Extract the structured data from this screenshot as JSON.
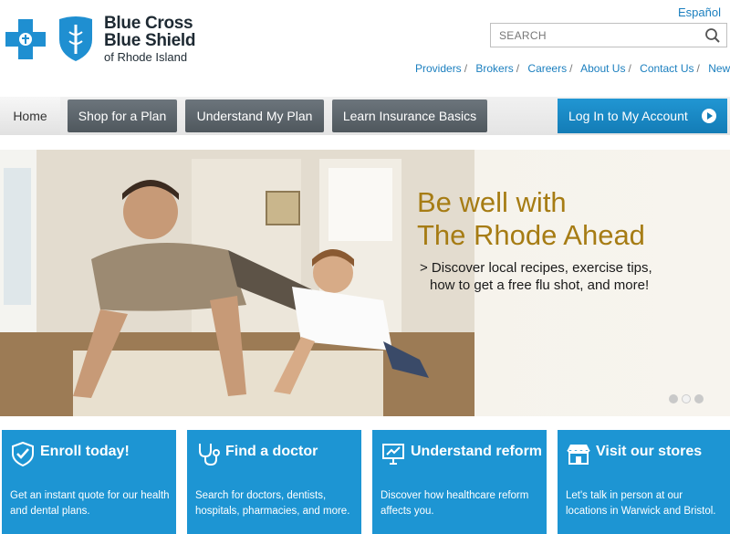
{
  "header": {
    "logo": {
      "line1": "Blue Cross",
      "line2": "Blue Shield",
      "line3": "of Rhode Island"
    },
    "espanol": "Español",
    "search_placeholder": "SEARCH",
    "links": [
      "Providers",
      "Brokers",
      "Careers",
      "About Us",
      "Contact Us",
      "News"
    ]
  },
  "nav": {
    "home": "Home",
    "shop": "Shop for a Plan",
    "understand": "Understand My Plan",
    "learn": "Learn Insurance Basics",
    "login": "Log In to My Account"
  },
  "hero": {
    "headline_line1": "Be well with",
    "headline_line2": "The Rhode Ahead",
    "body_line1": "> Discover local recipes, exercise tips,",
    "body_line2": "how to get a free flu shot, and more!",
    "slides": 3,
    "active_slide": 2
  },
  "cards": [
    {
      "title": "Enroll today!",
      "desc": "Get an instant quote for our health and dental plans."
    },
    {
      "title": "Find a doctor",
      "desc": "Search for doctors, dentists, hospitals, pharmacies, and more."
    },
    {
      "title": "Understand reform",
      "desc": "Discover how healthcare reform affects you."
    },
    {
      "title": "Visit our stores",
      "desc": "Let's talk in person at our locations in Warwick and Bristol."
    }
  ],
  "colors": {
    "brand_blue": "#1d95d3",
    "nav_dark": "#5d666c",
    "headline_gold": "#a67c14",
    "link_blue": "#1b7fbf"
  }
}
